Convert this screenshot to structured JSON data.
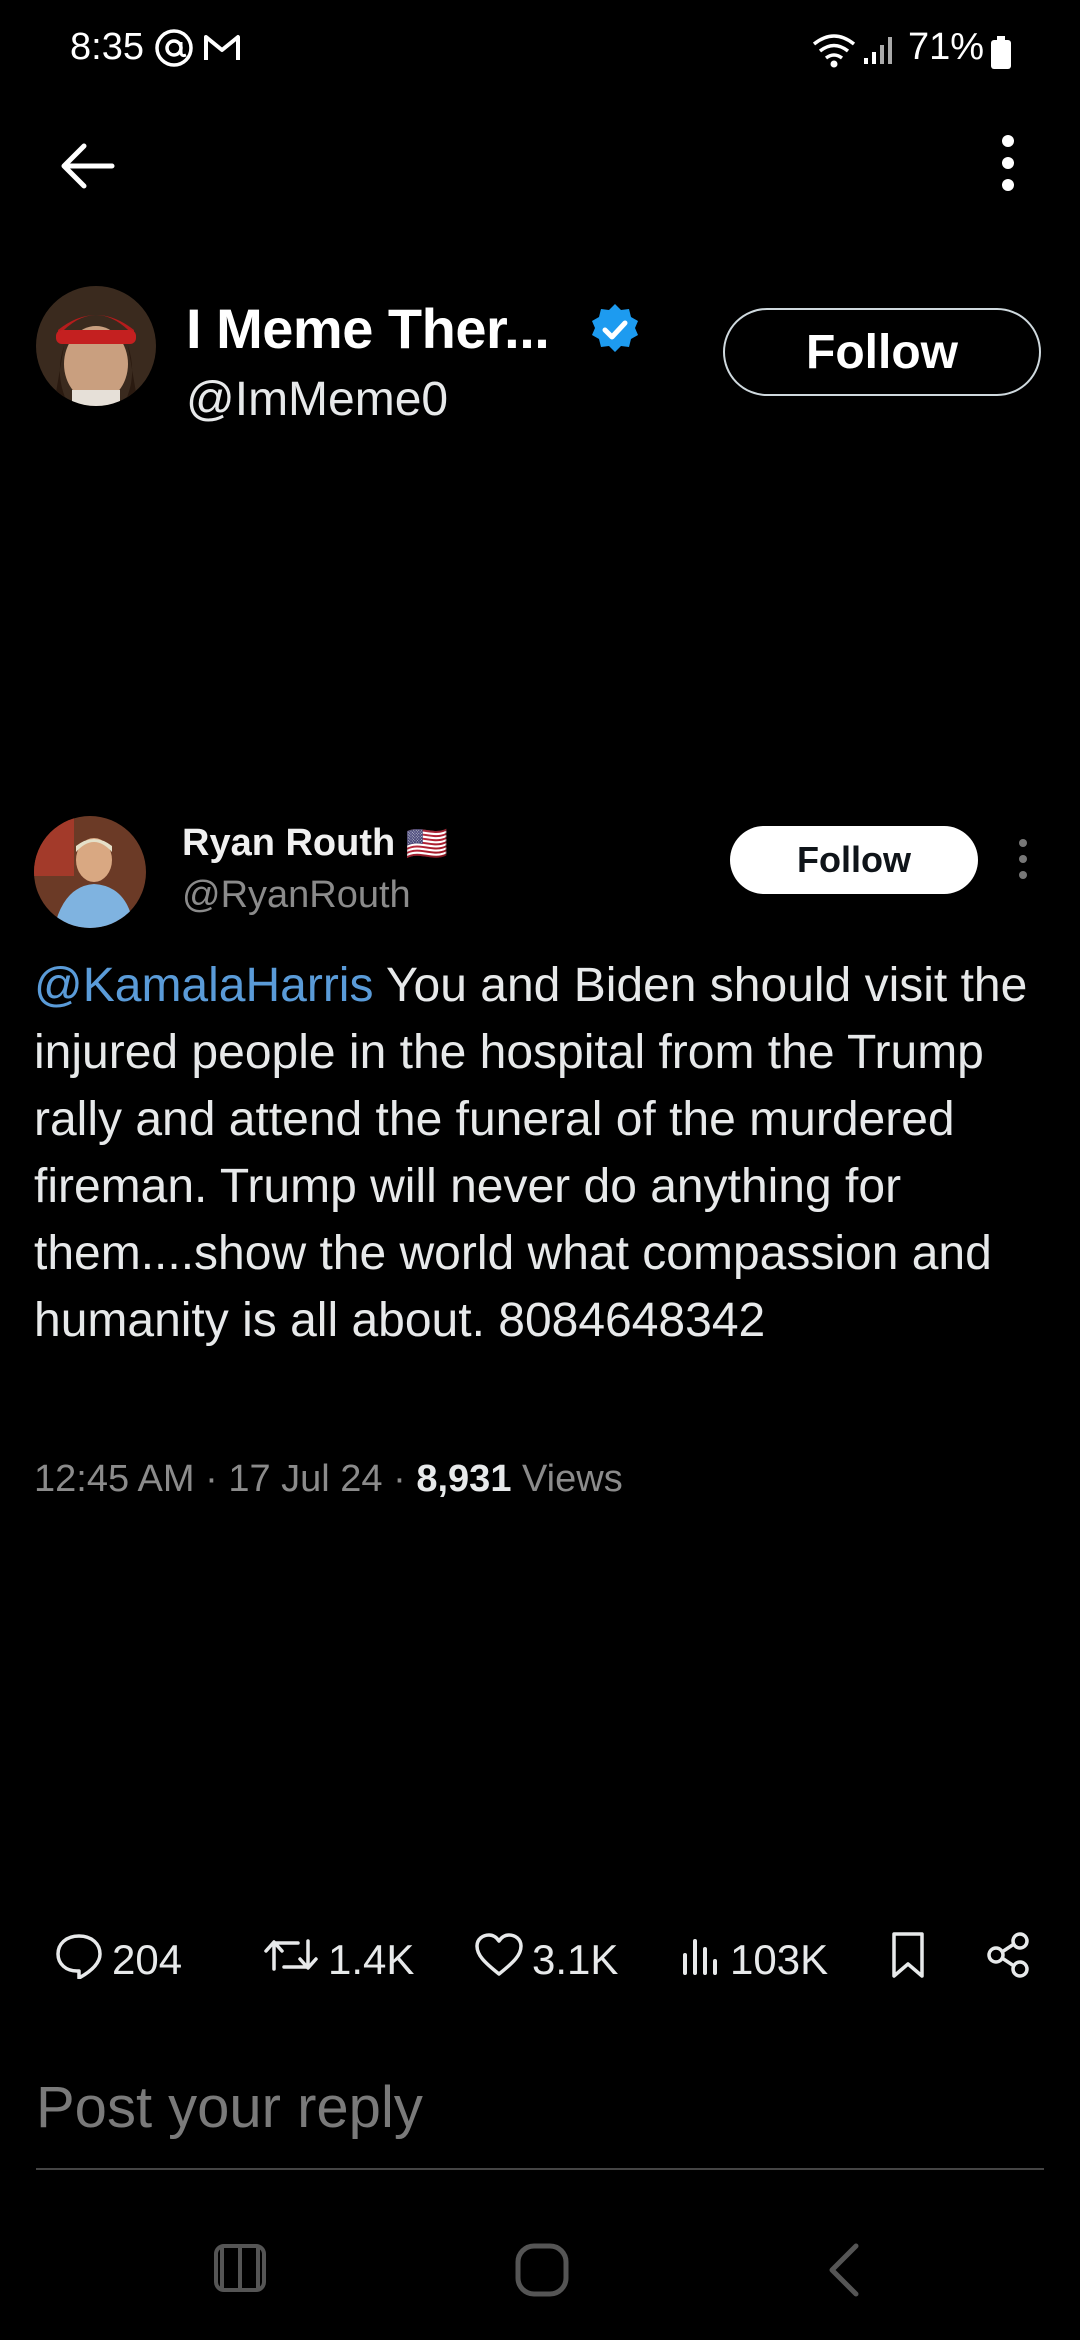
{
  "status_bar": {
    "time": "8:35",
    "battery": "71%"
  },
  "header": {
    "back_icon": "arrow-left-icon",
    "more_icon": "more-vertical-icon"
  },
  "author": {
    "name": "I Meme Ther...",
    "handle": "@ImMeme0",
    "verified": true,
    "follow_label": "Follow"
  },
  "embedded_post": {
    "name": "Ryan Routh",
    "flag": "🇺🇸",
    "handle": "@RyanRouth",
    "follow_label": "Follow",
    "mention": "@KamalaHarris",
    "text": " You and Biden should visit the injured people in the hospital from the Trump rally and attend the funeral of the murdered fireman. Trump will never do anything for them....show the world what compassion and humanity is all about. 8084648342",
    "time": "12:45 AM",
    "date": "17 Jul 24",
    "views_count": "8,931",
    "views_label": "Views"
  },
  "actions": {
    "replies": "204",
    "reposts": "1.4K",
    "likes": "3.1K",
    "views": "103K"
  },
  "reply": {
    "placeholder": "Post your reply"
  },
  "colors": {
    "accent": "#1d9bf0",
    "mention": "#5a9bd8",
    "muted": "#8b8b8b"
  }
}
